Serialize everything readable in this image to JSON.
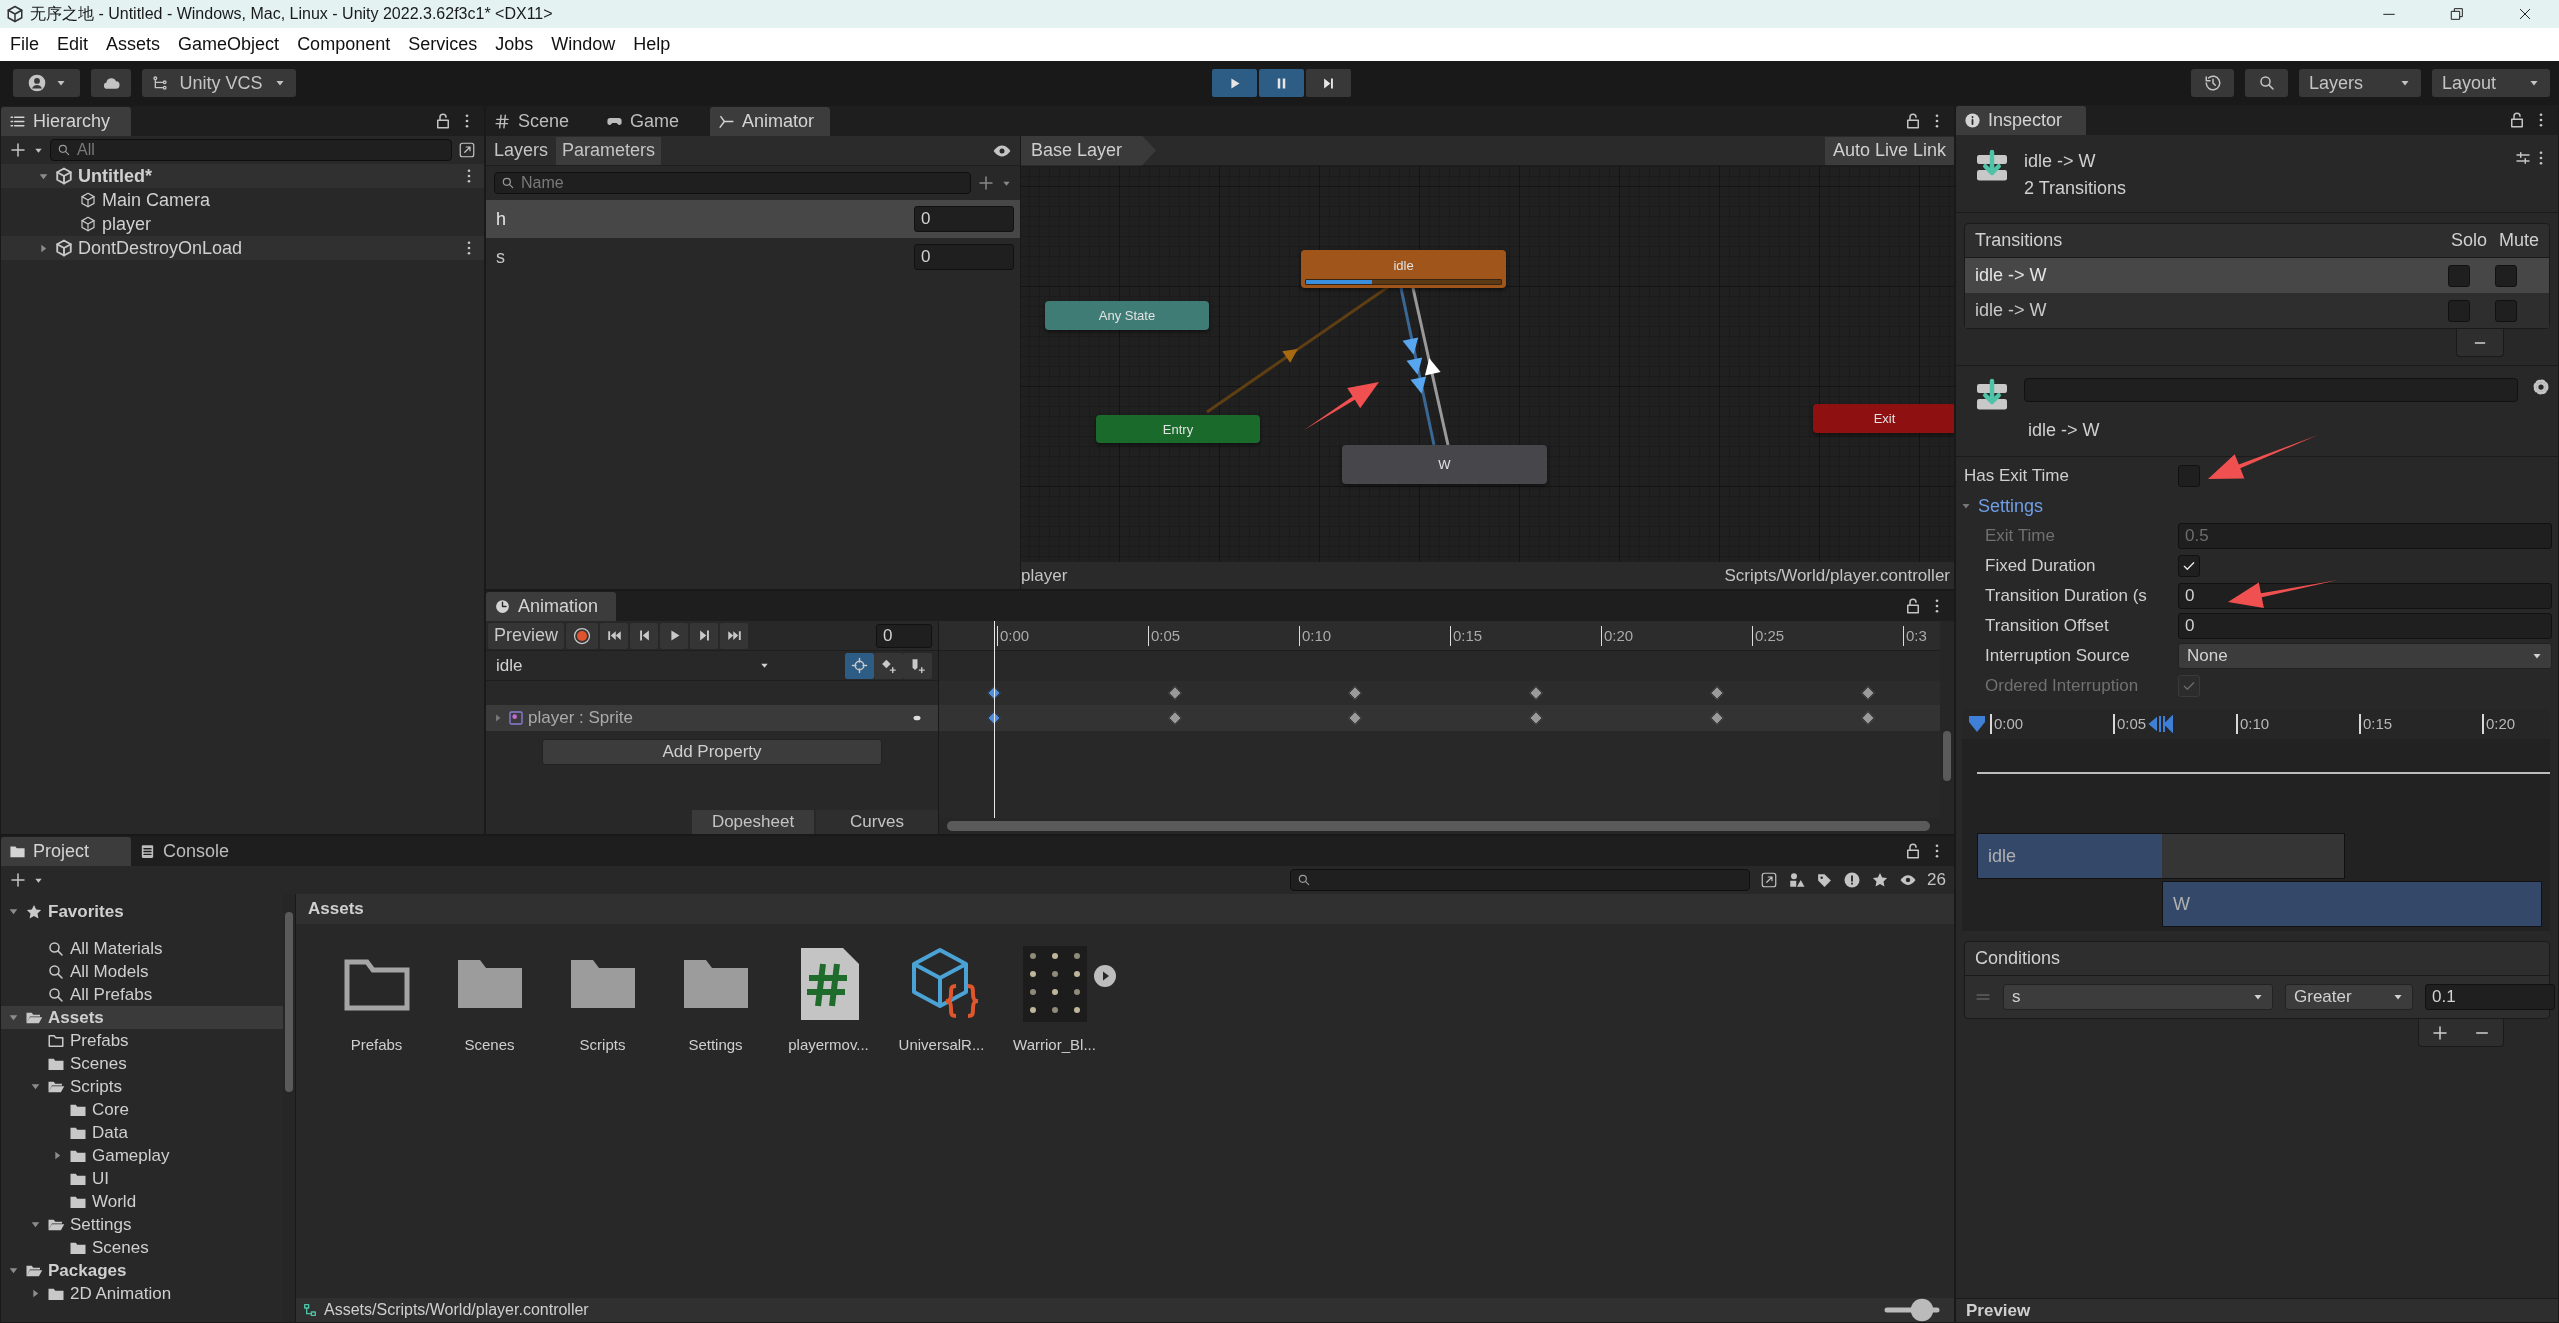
{
  "window": {
    "title": "无序之地 - Untitled - Windows, Mac, Linux - Unity 2022.3.62f3c1* <DX11>"
  },
  "menu": [
    "File",
    "Edit",
    "Assets",
    "GameObject",
    "Component",
    "Services",
    "Jobs",
    "Window",
    "Help"
  ],
  "toolbar": {
    "vcs": "Unity VCS",
    "play": [
      {
        "kind": "play",
        "on": true
      },
      {
        "kind": "pause",
        "on": true
      },
      {
        "kind": "step",
        "on": false
      }
    ],
    "layers": "Layers",
    "layout": "Layout"
  },
  "hierarchy": {
    "title": "Hierarchy",
    "search": {
      "placeholder": "All"
    },
    "items": [
      {
        "label": "Untitled*",
        "kind": "scene",
        "active": true,
        "expanded": true,
        "children": [
          {
            "label": "Main Camera",
            "kind": "object"
          },
          {
            "label": "player",
            "kind": "object"
          }
        ]
      },
      {
        "label": "DontDestroyOnLoad",
        "kind": "scene",
        "active": false,
        "expanded": false
      }
    ]
  },
  "center_tabs": [
    {
      "label": "Scene",
      "kind": "hash",
      "selected": false
    },
    {
      "label": "Game",
      "kind": "gamepad",
      "selected": false
    },
    {
      "label": "Animator",
      "kind": "fork",
      "selected": true
    }
  ],
  "animator": {
    "tabs": [
      {
        "label": "Layers",
        "selected": false
      },
      {
        "label": "Parameters",
        "selected": true
      }
    ],
    "search": {
      "placeholder": "Name"
    },
    "parameters": [
      {
        "name": "h",
        "value": "0",
        "selected": true
      },
      {
        "name": "s",
        "value": "0",
        "selected": false
      }
    ],
    "breadcrumb": "Base Layer",
    "live_link": "Auto Live Link",
    "states": [
      {
        "label": "Any State",
        "kind": "any"
      },
      {
        "label": "idle",
        "kind": "default",
        "level": 0.34
      },
      {
        "label": "Entry",
        "kind": "entry"
      },
      {
        "label": "W",
        "kind": "normal"
      },
      {
        "label": "Exit",
        "kind": "exit"
      }
    ],
    "footer_left": "player",
    "footer_right": "Scripts/World/player.controller"
  },
  "animation": {
    "title": "Animation",
    "preview": "Preview",
    "frame": "0",
    "clip": "idle",
    "tools": [
      {
        "kind": "crosshair",
        "on": true
      },
      {
        "kind": "add-key",
        "on": false
      },
      {
        "kind": "add-event",
        "on": false
      }
    ],
    "ruler": [
      "0:00",
      "0:05",
      "0:10",
      "0:15",
      "0:20",
      "0:25",
      "0:3"
    ],
    "properties": [
      {
        "label": "player : Sprite"
      }
    ],
    "add_property": "Add Property",
    "tabs": [
      {
        "label": "Dopesheet",
        "selected": true
      },
      {
        "label": "Curves",
        "selected": false
      }
    ]
  },
  "project": {
    "tabs": [
      {
        "label": "Project",
        "kind": "folder",
        "selected": true
      },
      {
        "label": "Console",
        "kind": "console",
        "selected": false
      }
    ],
    "hidden_count": "26",
    "tree": [
      {
        "label": "Favorites",
        "kind": "favorites",
        "selected": false,
        "expanded": true,
        "children": [
          {
            "label": "All Materials",
            "kind": "search",
            "selected": false
          },
          {
            "label": "All Models",
            "kind": "search",
            "selected": false
          },
          {
            "label": "All Prefabs",
            "kind": "search",
            "selected": false
          }
        ]
      },
      {
        "label": "Assets",
        "kind": "folder-open",
        "selected": true,
        "expanded": true,
        "children": [
          {
            "label": "Prefabs",
            "kind": "folder-outline",
            "selected": false
          },
          {
            "label": "Scenes",
            "kind": "folder",
            "selected": false
          },
          {
            "label": "Scripts",
            "kind": "folder-open",
            "selected": false,
            "expanded": true,
            "children": [
              {
                "label": "Core",
                "kind": "folder",
                "selected": false
              },
              {
                "label": "Data",
                "kind": "folder",
                "selected": false
              },
              {
                "label": "Gameplay",
                "kind": "folder",
                "selected": false,
                "expanded": false
              },
              {
                "label": "UI",
                "kind": "folder",
                "selected": false
              },
              {
                "label": "World",
                "kind": "folder",
                "selected": false
              }
            ]
          },
          {
            "label": "Settings",
            "kind": "folder-open",
            "selected": false,
            "expanded": true,
            "children": [
              {
                "label": "Scenes",
                "kind": "folder",
                "selected": false
              }
            ]
          }
        ]
      },
      {
        "label": "Packages",
        "kind": "folder-open",
        "selected": false,
        "expanded": true,
        "children": [
          {
            "label": "2D Animation",
            "kind": "folder",
            "selected": false,
            "expanded": false
          }
        ]
      }
    ],
    "breadcrumb": "Assets",
    "assets": [
      {
        "label": "Prefabs",
        "kind": "folder-outline"
      },
      {
        "label": "Scenes",
        "kind": "folder"
      },
      {
        "label": "Scripts",
        "kind": "folder"
      },
      {
        "label": "Settings",
        "kind": "folder"
      },
      {
        "label": "playermov...",
        "kind": "script"
      },
      {
        "label": "UniversalR...",
        "kind": "asset"
      },
      {
        "label": "Warrior_Bl...",
        "kind": "sprite"
      }
    ],
    "path": "Assets/Scripts/World/player.controller"
  },
  "inspector": {
    "title": "Inspector",
    "header": {
      "title": "idle -> W",
      "subtitle": "2 Transitions"
    },
    "transitions": {
      "columns": [
        "Transitions",
        "Solo",
        "Mute"
      ],
      "rows": [
        {
          "label": "idle -> W",
          "selected": true,
          "solo": false,
          "mute": false
        },
        {
          "label": "idle -> W",
          "selected": false,
          "solo": false,
          "mute": false
        }
      ]
    },
    "transition_name": "idle -> W",
    "has_exit_time": {
      "label": "Has Exit Time",
      "checked": false
    },
    "settings": {
      "label": "Settings",
      "expanded": true,
      "fields": [
        {
          "label": "Exit Time",
          "kind": "number",
          "value": "0.5",
          "disabled": true
        },
        {
          "label": "Fixed Duration",
          "kind": "checkbox",
          "checked": true,
          "disabled": false
        },
        {
          "label": "Transition Duration (s",
          "kind": "number",
          "value": "0",
          "disabled": false
        },
        {
          "label": "Transition Offset",
          "kind": "number",
          "value": "0",
          "disabled": false
        },
        {
          "label": "Interruption Source",
          "kind": "dropdown",
          "value": "None",
          "disabled": false
        },
        {
          "label": "Ordered Interruption",
          "kind": "checkbox",
          "checked": true,
          "disabled": true
        }
      ]
    },
    "timeline": {
      "ruler": [
        "0:00",
        "0:05",
        "0:10",
        "0:15",
        "0:20"
      ],
      "bars": [
        {
          "label": "idle"
        },
        {
          "label": "W"
        }
      ]
    },
    "conditions": {
      "title": "Conditions",
      "items": [
        {
          "parameter": "s",
          "mode": "Greater",
          "value": "0.1"
        }
      ]
    },
    "preview": "Preview"
  }
}
